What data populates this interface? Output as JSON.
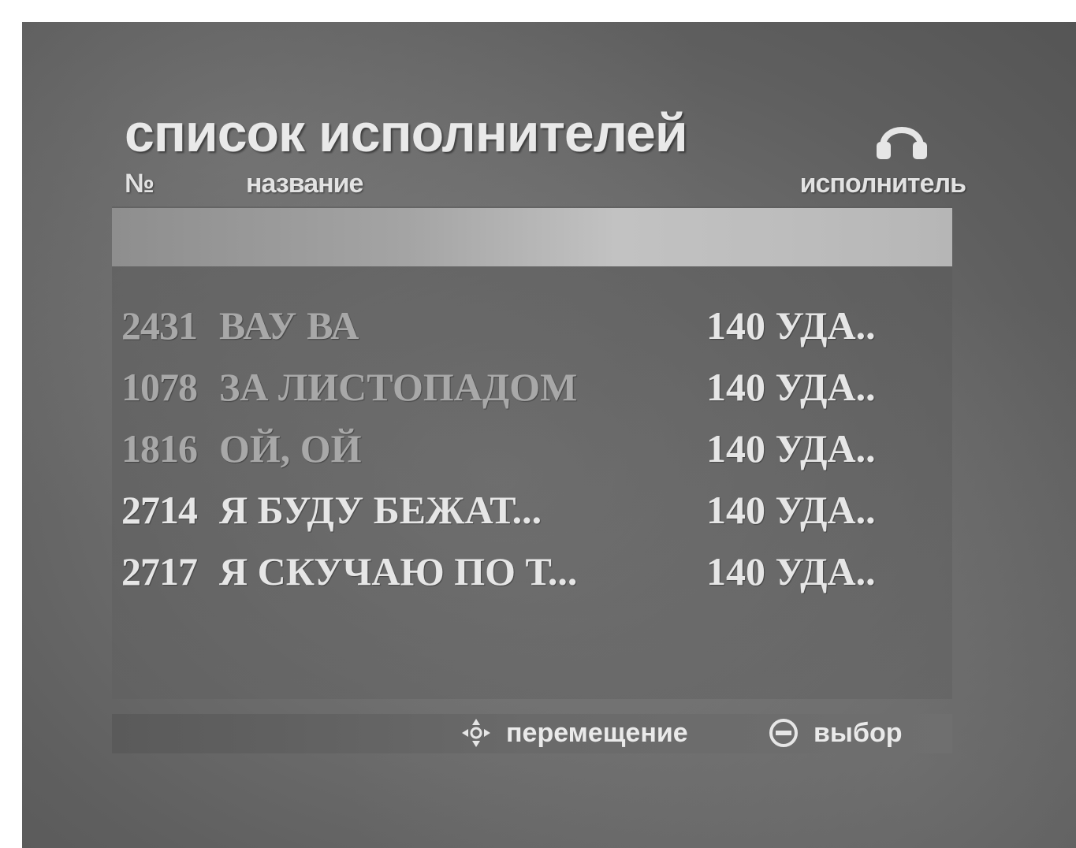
{
  "screen": {
    "title": "список исполнителей",
    "title_icon": "headphones-icon"
  },
  "columns": {
    "number": "№",
    "name": "название",
    "artist": "исполнитель"
  },
  "rows": [
    {
      "num": "2431",
      "song": "ВАУ  ВА",
      "artist": "140 УДА..",
      "dimmed": true
    },
    {
      "num": "1078",
      "song": "ЗА  ЛИСТОПАДОМ",
      "artist": "140 УДА..",
      "dimmed": true
    },
    {
      "num": "1816",
      "song": "ОЙ,  ОЙ",
      "artist": "140 УДА..",
      "dimmed": true
    },
    {
      "num": "2714",
      "song": "Я  БУДУ  БЕЖАТ...",
      "artist": "140 УДА..",
      "dimmed": false
    },
    {
      "num": "2717",
      "song": "Я  СКУЧАЮ ПО Т...",
      "artist": "140 УДА..",
      "dimmed": false
    }
  ],
  "footer": {
    "move_icon": "dpad-icon",
    "move_label": "перемещение",
    "select_icon": "enter-icon",
    "select_label": "выбор"
  }
}
